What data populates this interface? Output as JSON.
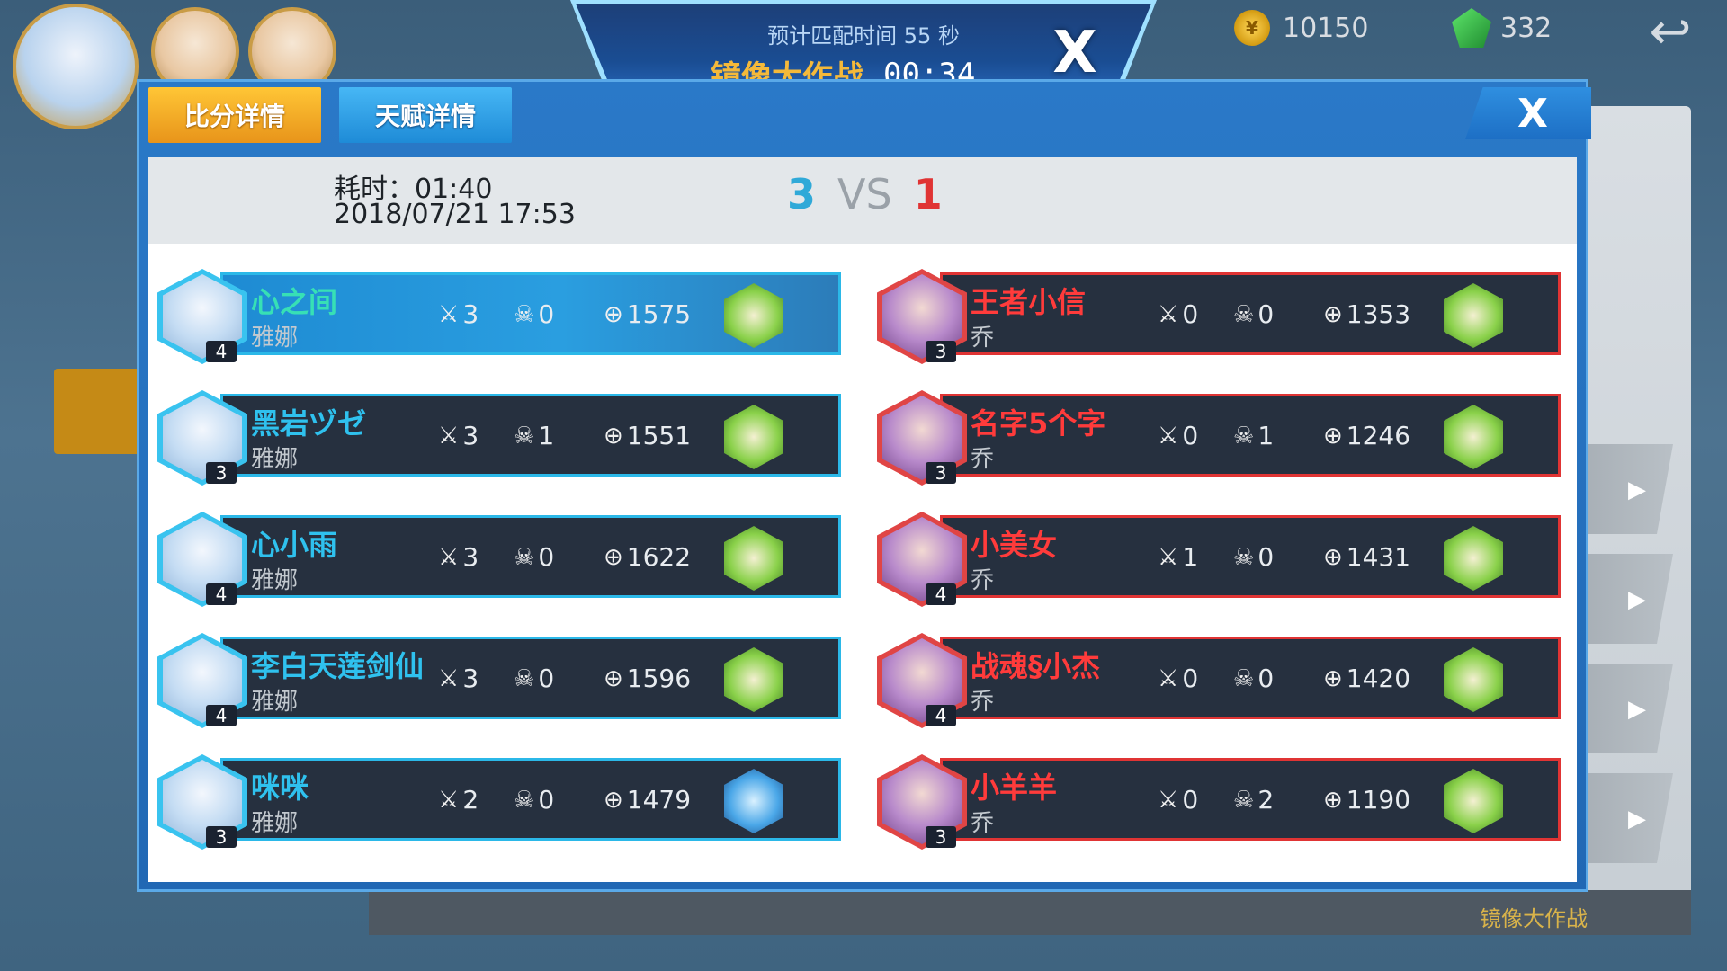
{
  "header": {
    "eta_text": "预计匹配时间 55 秒",
    "mode_name": "镜像大作战",
    "timer": "00:34",
    "close_label": "X"
  },
  "currency": {
    "coins": "10150",
    "gems": "332"
  },
  "tabs": [
    {
      "label": "比分详情"
    },
    {
      "label": "天赋详情"
    }
  ],
  "dialog_close_label": "X",
  "match": {
    "duration": "耗时：01:40",
    "datetime": "2018/07/21 17:53",
    "score_blue": "3",
    "vs": "VS",
    "score_red": "1"
  },
  "blue_team": [
    {
      "name": "心之间",
      "hero": "雅娜",
      "level": "4",
      "kills": "3",
      "deaths": "0",
      "points": "1575"
    },
    {
      "name": "黑岩ヅゼ",
      "hero": "雅娜",
      "level": "3",
      "kills": "3",
      "deaths": "1",
      "points": "1551"
    },
    {
      "name": "心小雨",
      "hero": "雅娜",
      "level": "4",
      "kills": "3",
      "deaths": "0",
      "points": "1622"
    },
    {
      "name": "李白天莲剑仙",
      "hero": "雅娜",
      "level": "4",
      "kills": "3",
      "deaths": "0",
      "points": "1596"
    },
    {
      "name": "咪咪",
      "hero": "雅娜",
      "level": "3",
      "kills": "2",
      "deaths": "0",
      "points": "1479"
    }
  ],
  "red_team": [
    {
      "name": "王者小信",
      "hero": "乔",
      "level": "3",
      "kills": "0",
      "deaths": "0",
      "points": "1353"
    },
    {
      "name": "名字5个字",
      "hero": "乔",
      "level": "3",
      "kills": "0",
      "deaths": "1",
      "points": "1246"
    },
    {
      "name": "小美女",
      "hero": "乔",
      "level": "4",
      "kills": "1",
      "deaths": "0",
      "points": "1431"
    },
    {
      "name": "战魂§小杰",
      "hero": "乔",
      "level": "4",
      "kills": "0",
      "deaths": "0",
      "points": "1420"
    },
    {
      "name": "小羊羊",
      "hero": "乔",
      "level": "3",
      "kills": "0",
      "deaths": "2",
      "points": "1190"
    }
  ],
  "background": {
    "bottom_label": "镜像大作战"
  }
}
